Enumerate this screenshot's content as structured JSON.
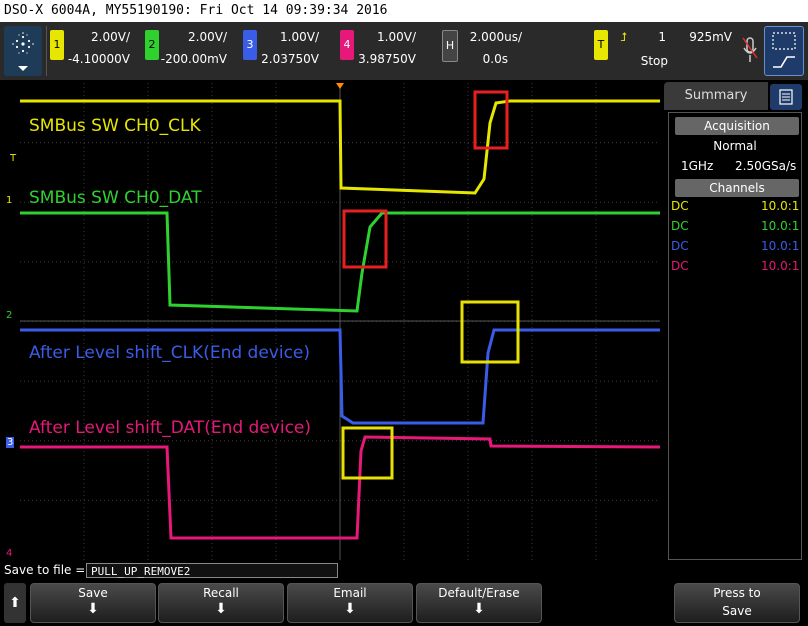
{
  "title_bar": "DSO-X 6004A, MY55190190: Fri Oct 14 09:39:34 2016",
  "channels": [
    {
      "num": "1",
      "scale": "2.00V/",
      "offset": "-4.10000V",
      "color": "#e7e600"
    },
    {
      "num": "2",
      "scale": "2.00V/",
      "offset": "-200.00mV",
      "color": "#2fd12f"
    },
    {
      "num": "3",
      "scale": "1.00V/",
      "offset": "2.03750V",
      "color": "#3a5de8"
    },
    {
      "num": "4",
      "scale": "1.00V/",
      "offset": "3.98750V",
      "color": "#e6197a"
    }
  ],
  "horizontal": {
    "badge": "H",
    "scale": "2.000us/",
    "position": "0.0s"
  },
  "trigger": {
    "badge": "T",
    "source": "1",
    "level": "925mV",
    "mode": "Stop",
    "edge_symbol": "⮥"
  },
  "waveform_labels": {
    "ch1": "SMBus SW CH0_CLK",
    "ch2": "SMBus SW CH0_DAT",
    "ch3": "After Level shift_CLK(End device)",
    "ch4": "After Level shift_DAT(End device)"
  },
  "markers": {
    "t": "T",
    "m1": "1",
    "m2": "2",
    "m3": "3",
    "m4": "4"
  },
  "summary": {
    "tab": "Summary",
    "acquisition_header": "Acquisition",
    "acq_mode": "Normal",
    "bandwidth": "1GHz",
    "sample_rate": "2.50GSa/s",
    "channels_header": "Channels",
    "rows": [
      {
        "coupling": "DC",
        "probe": "10.0:1"
      },
      {
        "coupling": "DC",
        "probe": "10.0:1"
      },
      {
        "coupling": "DC",
        "probe": "10.0:1"
      },
      {
        "coupling": "DC",
        "probe": "10.0:1"
      }
    ]
  },
  "save_bar": {
    "label": "Save to file =",
    "filename": "PULL_UP_REMOVE2"
  },
  "softkeys": [
    {
      "label": "Save"
    },
    {
      "label": "Recall"
    },
    {
      "label": "Email"
    },
    {
      "label": "Default/Erase"
    }
  ],
  "press_to_save": {
    "line1": "Press to",
    "line2": "Save"
  },
  "colors": {
    "grid": "#3c3c3c",
    "highlight_red": "#e62020",
    "highlight_yellow": "#e8e000",
    "panel_bg": "#2a2a2a"
  }
}
